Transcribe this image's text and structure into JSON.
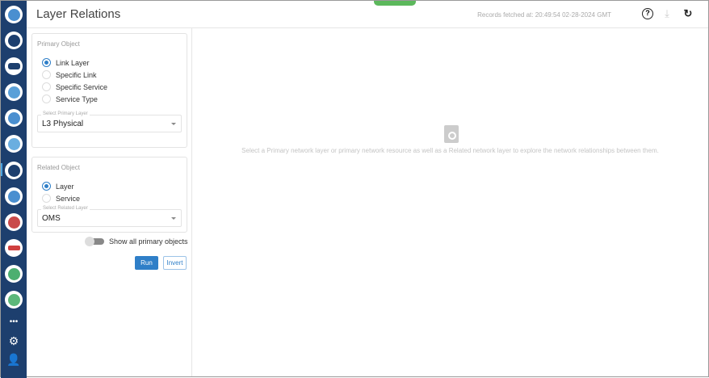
{
  "header": {
    "title": "Layer Relations",
    "fetched": "Records fetched at: 20:49:54 02-28-2024 GMT"
  },
  "sidebar": {
    "icons": [
      "network-icon",
      "topology-icon",
      "sql-icon",
      "globe-icon",
      "link-icon",
      "map-icon",
      "layers-icon",
      "trend-icon",
      "route-icon",
      "inspect-icon",
      "document-icon",
      "triangle-icon"
    ],
    "more": "•••",
    "colors": {
      "bg": "#1d3f6e",
      "accent": "#2f7fc8"
    }
  },
  "primary": {
    "title": "Primary Object",
    "options": [
      "Link Layer",
      "Specific Link",
      "Specific Service",
      "Service Type"
    ],
    "selected": 0,
    "select_label": "Select Primary Layer",
    "select_value": "L3 Physical"
  },
  "related": {
    "title": "Related Object",
    "options": [
      "Layer",
      "Service"
    ],
    "selected": 0,
    "select_label": "Select Related Layer",
    "select_value": "OMS"
  },
  "toggle": {
    "label": "Show all primary objects",
    "on": false
  },
  "buttons": {
    "run": "Run",
    "invert": "Invert"
  },
  "empty": {
    "message": "Select a Primary network layer or primary network resource as well as a Related network layer to explore the network relationships between them."
  }
}
